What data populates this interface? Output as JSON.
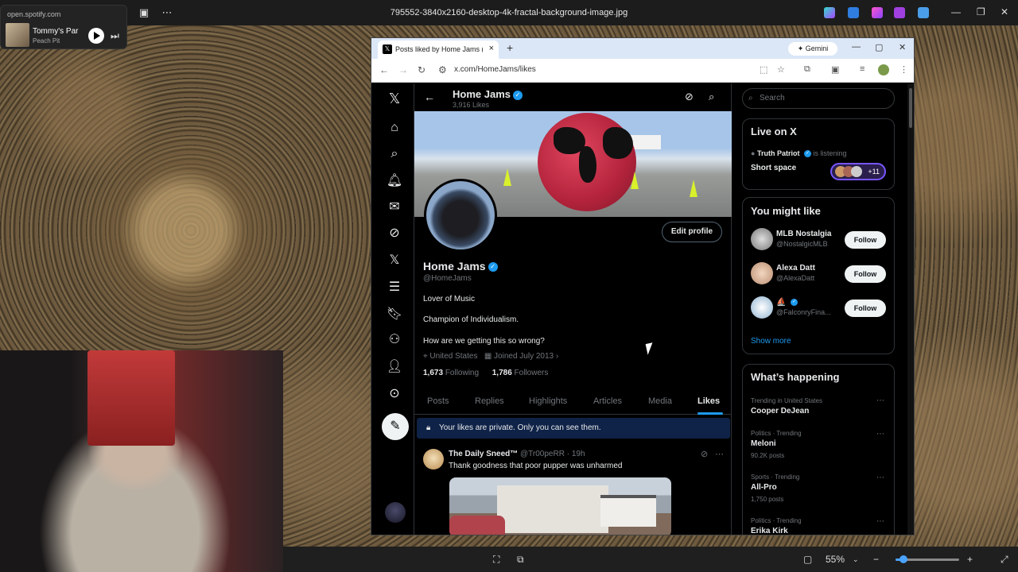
{
  "viewer": {
    "title": "795552-3840x2160-desktop-4k-fractal-background-image.jpg",
    "zoom": "55%",
    "zoom_level": 0.12
  },
  "spotify": {
    "url": "open.spotify.com",
    "track": "Tommy's Par",
    "artist": "Peach Pit"
  },
  "browser": {
    "tab_title": "Posts liked by Home Jams (@H",
    "url": "x.com/HomeJams/likes",
    "gemini_label": "Gemini"
  },
  "profile": {
    "header_name": "Home Jams",
    "likes_count": "3,916 Likes",
    "name": "Home Jams",
    "handle": "@HomeJams",
    "bio1": "Lover of Music",
    "bio2": "Champion of Individualism.",
    "bio3": "How are we getting this so wrong?",
    "location": "United States",
    "joined": "Joined July 2013",
    "following_count": "1,673",
    "following_label": "Following",
    "followers_count": "1,786",
    "followers_label": "Followers",
    "edit_label": "Edit profile",
    "tabs": [
      "Posts",
      "Replies",
      "Highlights",
      "Articles",
      "Media",
      "Likes"
    ],
    "active_tab": "Likes",
    "private_notice": "Your likes are private. Only you can see them."
  },
  "tweet": {
    "author": "The Daily Sneed™",
    "handle_time": "@Tr00peRR · 19h",
    "text": "Thank goodness that poor pupper was unharmed"
  },
  "sidebar": {
    "search_placeholder": "Search",
    "live": {
      "title": "Live on X",
      "host": "Truth Patriot",
      "status": "is listening",
      "space": "Short space",
      "count": "+11"
    },
    "wtf": {
      "title": "You might like",
      "users": [
        {
          "name": "MLB Nostalgia",
          "handle": "@NostalgicMLB",
          "button": "Follow"
        },
        {
          "name": "Alexa Datt",
          "handle": "@AlexaDatt",
          "button": "Follow"
        },
        {
          "name": "⛵",
          "handle": "@FalconryFina...",
          "button": "Follow"
        }
      ],
      "show_more": "Show more"
    },
    "happening": {
      "title": "What’s happening",
      "trends": [
        {
          "meta": "Trending in United States",
          "name": "Cooper DeJean",
          "count": ""
        },
        {
          "meta": "Politics · Trending",
          "name": "Meloni",
          "count": "90.2K posts"
        },
        {
          "meta": "Sports · Trending",
          "name": "All-Pro",
          "count": "1,750 posts"
        },
        {
          "meta": "Politics · Trending",
          "name": "Erika Kirk",
          "count": ""
        }
      ]
    }
  },
  "colors": {
    "x_blue": "#1d9bf0",
    "background": "#000000",
    "text": "#e7e9ea",
    "muted": "#71767b",
    "space_purple": "#7856ff"
  }
}
